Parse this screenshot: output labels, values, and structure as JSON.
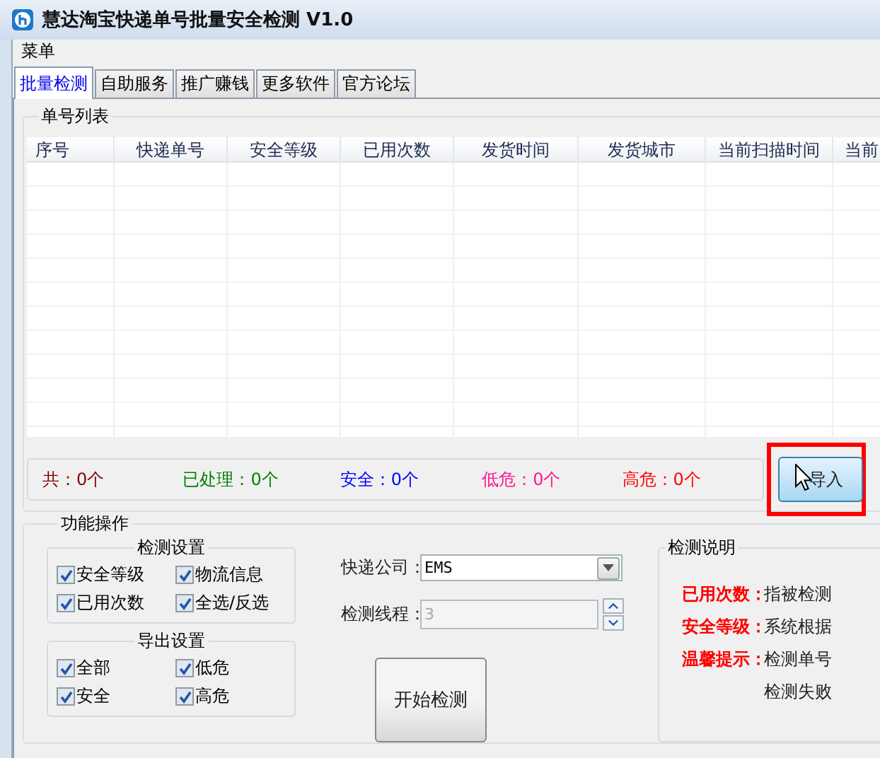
{
  "window": {
    "title": "慧达淘宝快递单号批量安全检测 V1.0"
  },
  "menu": [
    "菜单"
  ],
  "tabs": [
    {
      "label": "批量检测",
      "selected": true
    },
    {
      "label": "自助服务",
      "selected": false
    },
    {
      "label": "推广赚钱",
      "selected": false
    },
    {
      "label": "更多软件",
      "selected": false
    },
    {
      "label": "官方论坛",
      "selected": false
    }
  ],
  "list_group": {
    "title": "单号列表",
    "columns": [
      "序号",
      "快递单号",
      "安全等级",
      "已用次数",
      "发货时间",
      "发货城市",
      "当前扫描时间",
      "当前"
    ]
  },
  "stats": [
    {
      "label": "共：",
      "value": "0个",
      "color": "#800000"
    },
    {
      "label": "已处理：",
      "value": "0个",
      "color": "#008000"
    },
    {
      "label": "安全：",
      "value": "0个",
      "color": "#0000ff"
    },
    {
      "label": "低危：",
      "value": "0个",
      "color": "#ff1493"
    },
    {
      "label": "高危：",
      "value": "0个",
      "color": "#ff0000"
    }
  ],
  "import_button": {
    "label": "导入",
    "highlighted": true
  },
  "operations": {
    "title": "功能操作",
    "detect_settings": {
      "title": "检测设置",
      "options": [
        {
          "label": "安全等级",
          "checked": true
        },
        {
          "label": "物流信息",
          "checked": true
        },
        {
          "label": "已用次数",
          "checked": true
        },
        {
          "label": "全选/反选",
          "checked": true
        }
      ]
    },
    "export_settings": {
      "title": "导出设置",
      "options": [
        {
          "label": "全部",
          "checked": true
        },
        {
          "label": "低危",
          "checked": true
        },
        {
          "label": "安全",
          "checked": true
        },
        {
          "label": "高危",
          "checked": true
        }
      ]
    },
    "courier": {
      "label": "快递公司：",
      "value": "EMS"
    },
    "threads": {
      "label": "检测线程：",
      "value": "3",
      "disabled": true
    },
    "start_button": "开始检测"
  },
  "notes": {
    "title": "检测说明",
    "lines": [
      {
        "term": "已用次数：",
        "text": "指被检测"
      },
      {
        "term": "安全等级：",
        "text": "系统根据"
      },
      {
        "term": "温馨提示：",
        "text": "检测单号"
      },
      {
        "text": "检测失败"
      }
    ]
  }
}
